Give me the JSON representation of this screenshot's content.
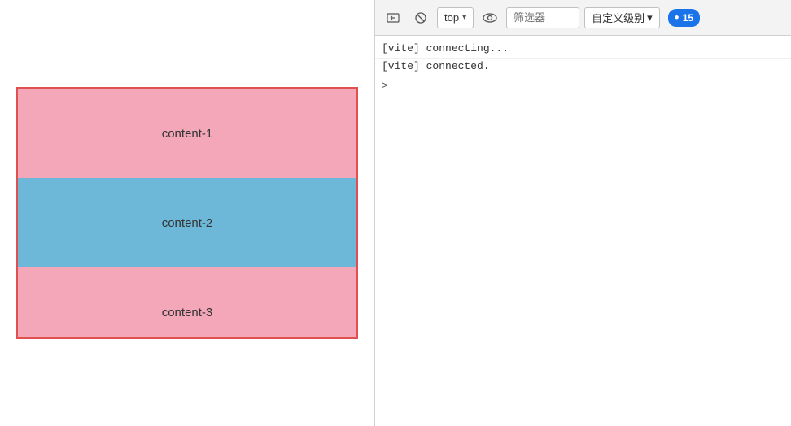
{
  "leftPanel": {
    "contents": [
      {
        "label": "content-1",
        "colorClass": "content-1"
      },
      {
        "label": "content-2",
        "colorClass": "content-2"
      },
      {
        "label": "content-3",
        "colorClass": "content-3"
      }
    ]
  },
  "devtools": {
    "toolbar": {
      "contextSelector": {
        "value": "top",
        "chevron": "▾"
      },
      "filterPlaceholder": "筛选器",
      "customLevelLabel": "自定义级别",
      "customLevelChevron": "▾",
      "messageCount": "15"
    },
    "console": {
      "lines": [
        "[vite] connecting...",
        "[vite] connected."
      ],
      "caret": ">"
    }
  },
  "icons": {
    "back": "⬚",
    "block": "⊘",
    "eye": "👁",
    "blueDot": "●"
  }
}
